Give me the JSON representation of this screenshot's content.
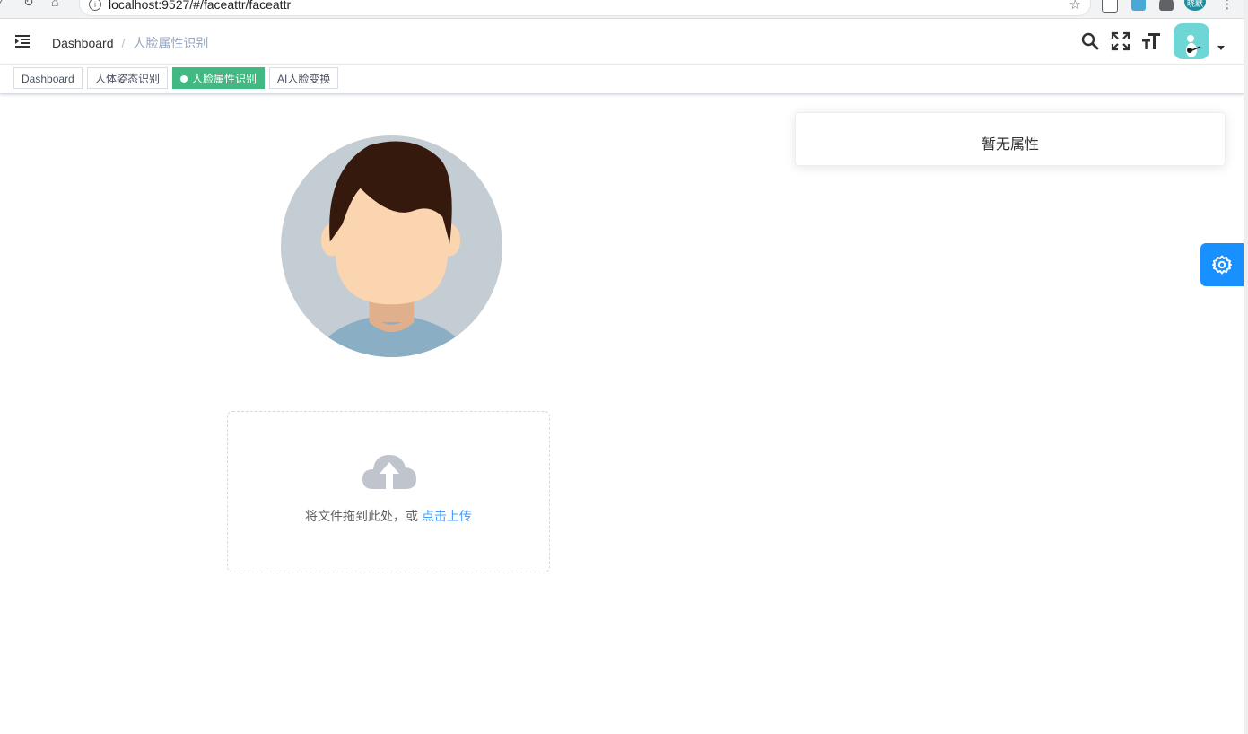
{
  "browser": {
    "url": "localhost:9527/#/faceattr/faceattr",
    "profile_label": "晓默"
  },
  "navbar": {
    "breadcrumb": [
      {
        "label": "Dashboard"
      },
      {
        "label": "人脸属性识别"
      }
    ],
    "icons": [
      "search-icon",
      "fullscreen-icon",
      "text-size-icon"
    ]
  },
  "tags": [
    {
      "label": "Dashboard",
      "active": false
    },
    {
      "label": "人体姿态识别",
      "active": false
    },
    {
      "label": "人脸属性识别",
      "active": true
    },
    {
      "label": "AI人脸变换",
      "active": false
    }
  ],
  "upload": {
    "hint": "将文件拖到此处，或",
    "link": "点击上传"
  },
  "attributes": {
    "empty_text": "暂无属性"
  },
  "colors": {
    "active_tag": "#42b983",
    "settings_button": "#1890ff",
    "link": "#409eff"
  }
}
